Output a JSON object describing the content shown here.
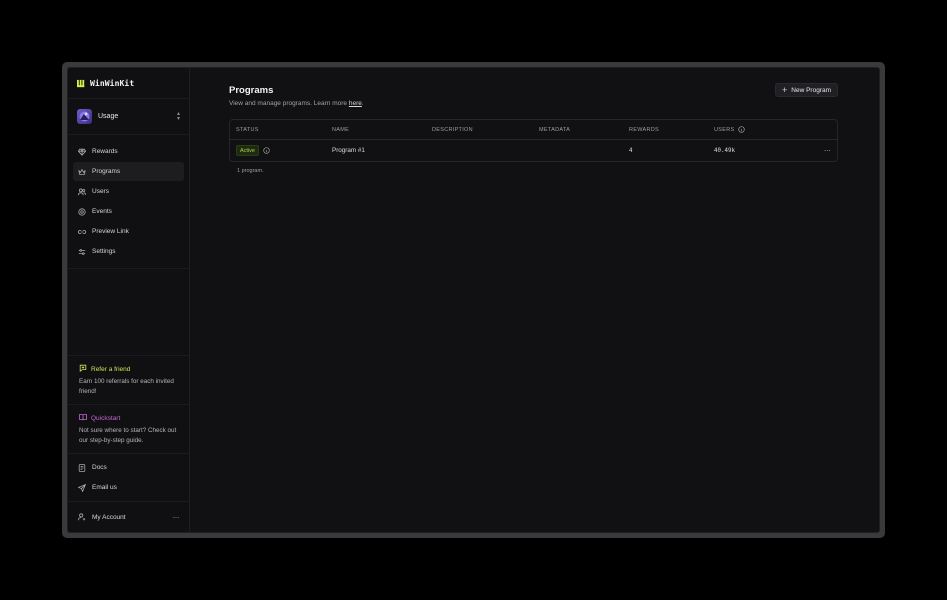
{
  "brand": {
    "name": "WinWinKit"
  },
  "workspace": {
    "name": "Usage"
  },
  "nav": [
    {
      "label": "Rewards",
      "icon": "gem-icon"
    },
    {
      "label": "Programs",
      "icon": "crown-icon",
      "active": true
    },
    {
      "label": "Users",
      "icon": "users-icon"
    },
    {
      "label": "Events",
      "icon": "target-icon"
    },
    {
      "label": "Preview Link",
      "icon": "link-icon"
    },
    {
      "label": "Settings",
      "icon": "sliders-icon"
    }
  ],
  "promos": {
    "refer": {
      "title": "Refer a friend",
      "text": "Earn 100 referrals for each invited friend!",
      "color": "#c7e85a"
    },
    "quickstart": {
      "title": "Quickstart",
      "text": "Not sure where to start? Check out our step-by-step guide.",
      "color": "#c565d9"
    }
  },
  "links": [
    {
      "label": "Docs",
      "icon": "doc-icon"
    },
    {
      "label": "Email us",
      "icon": "send-icon"
    }
  ],
  "account": {
    "label": "My Account"
  },
  "page": {
    "title": "Programs",
    "subtitle_prefix": "View and manage programs. Learn more ",
    "subtitle_link": "here",
    "subtitle_suffix": ".",
    "new_button": "New Program"
  },
  "table": {
    "columns": [
      "STATUS",
      "NAME",
      "DESCRIPTION",
      "METADATA",
      "REWARDS",
      "USERS"
    ],
    "rows": [
      {
        "status": "Active",
        "name": "Program #1",
        "description": "",
        "metadata": "",
        "rewards": "4",
        "users": "40.49k"
      }
    ],
    "count_text": "1 program."
  }
}
